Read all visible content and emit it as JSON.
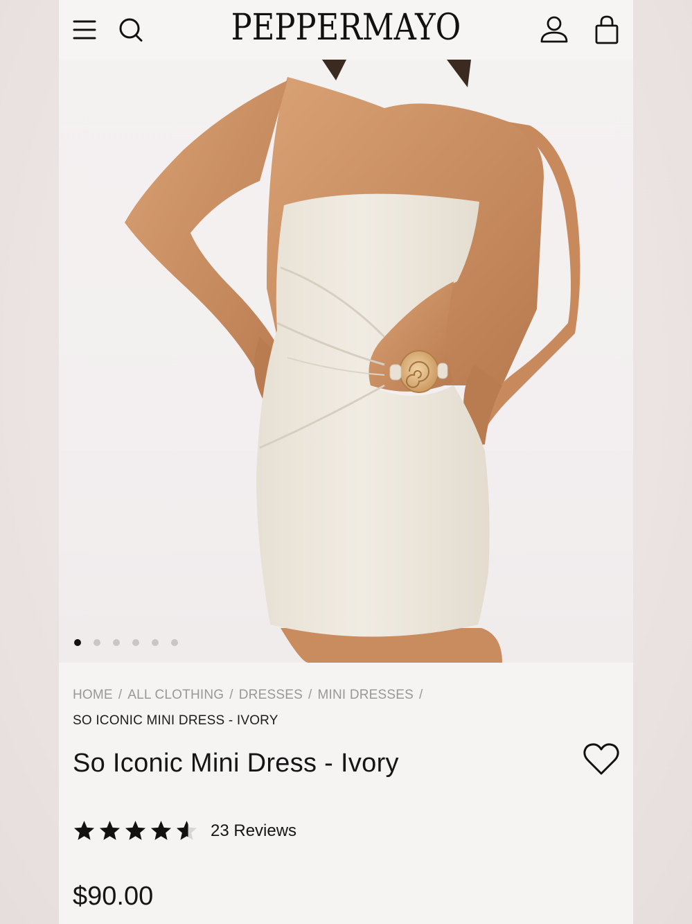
{
  "header": {
    "brand": "PEPPERMAYO"
  },
  "gallery": {
    "image_count": 6,
    "active_index": 0
  },
  "breadcrumb": {
    "items": [
      "HOME",
      "ALL CLOTHING",
      "DRESSES",
      "MINI DRESSES"
    ],
    "separator": "/",
    "current": "SO ICONIC MINI DRESS - IVORY"
  },
  "product": {
    "title": "So Iconic Mini Dress - Ivory",
    "rating": 4.5,
    "rating_max": 5,
    "reviews_label": "23 Reviews",
    "price": "$90.00"
  },
  "icons": {
    "menu": "menu-icon",
    "search": "search-icon",
    "account": "account-icon",
    "bag": "bag-icon",
    "wishlist": "heart-icon",
    "star": "star-icon"
  },
  "colors": {
    "text": "#151515",
    "muted": "#9a9797",
    "dress": "#ede7dc",
    "background": "#f6f4f2"
  }
}
